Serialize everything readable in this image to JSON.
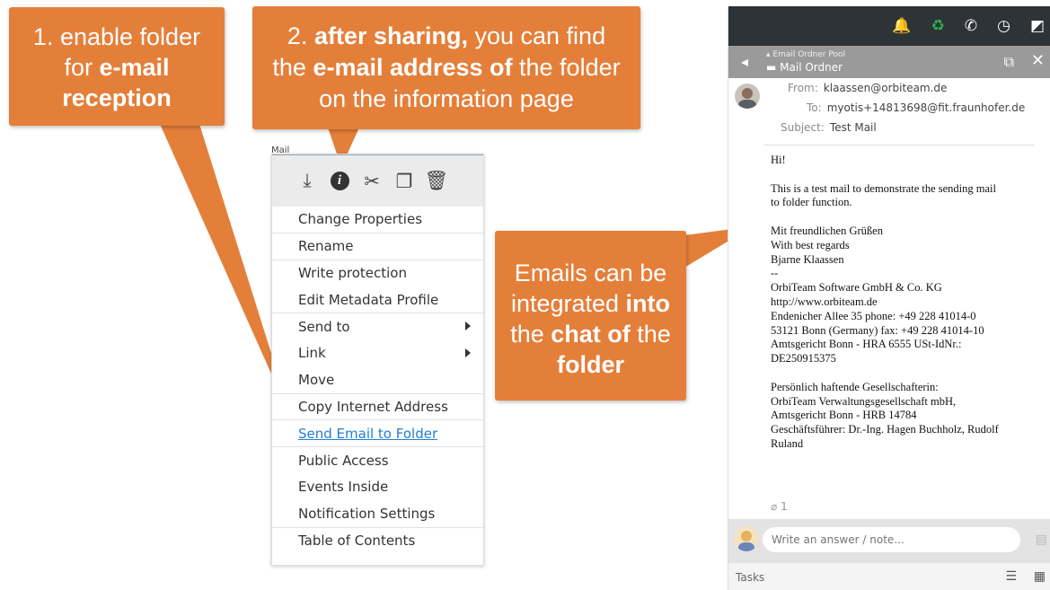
{
  "callouts": {
    "c1": {
      "l1_a": "1.",
      "l1_b": " enable folder",
      "l2_a": "for ",
      "l2_b": "e-mail",
      "l3": "reception"
    },
    "c2": {
      "l1_a": "2. ",
      "l1_b": "after sharing,",
      "l1_c": " you can find",
      "l2_a": "the ",
      "l2_b": "e-mail address of",
      "l2_c": " the folder",
      "l3": "on the information page"
    },
    "c3": {
      "l1": "Emails can be",
      "l2_a": "integrated ",
      "l2_b": "into",
      "l3_a": "the ",
      "l3_b": "chat of",
      "l3_c": " the",
      "l4": "folder"
    },
    "color": "#e47f3a"
  },
  "context_menu": {
    "clip_label": "Mail",
    "toolbar_icons": [
      "download-icon",
      "info-icon",
      "cut-icon",
      "copy-icon",
      "trash-icon"
    ],
    "items": [
      {
        "label": "Change Properties"
      },
      {
        "label": "Rename"
      },
      {
        "label": "Write protection"
      },
      {
        "label": "Edit Metadata Profile"
      },
      {
        "label": "Send to"
      },
      {
        "label": "Link"
      },
      {
        "label": "Move"
      },
      {
        "label": "Copy Internet Address"
      },
      {
        "label": "Send Email to Folder"
      },
      {
        "label": "Public Access"
      },
      {
        "label": "Events Inside"
      },
      {
        "label": "Notification Settings"
      },
      {
        "label": "Table of Contents"
      }
    ],
    "link_color": "#1f7fd6"
  },
  "mail_panel": {
    "breadcrumb": "Email Ordner Pool",
    "folder_title": "Mail Ordner",
    "header": {
      "from_label": "From:",
      "from_value": "klaassen@orbiteam.de",
      "to_label": "To:",
      "to_value": "myotis+14813698@fit.fraunhofer.de",
      "subject_label": "Subject:",
      "subject_value": "Test Mail"
    },
    "body": {
      "greeting": "Hi!",
      "para1_l1": "This is a test mail to demonstrate the sending mail",
      "para1_l2": "to folder function.",
      "sig1": "Mit freundlichen Grüßen",
      "sig2": "With best regards",
      "sig3": "Bjarne Klaassen",
      "sig4": "--",
      "sig5": "OrbiTeam Software GmbH & Co. KG",
      "sig6": "http://www.orbiteam.de",
      "sig7": "Endenicher Allee 35 phone: +49 228 41014-0",
      "sig8": "53121 Bonn (Germany) fax: +49 228 41014-10",
      "sig9": "Amtsgericht Bonn - HRA 6555 USt-IdNr.:",
      "sig10": "DE250915375",
      "legal1": "Persönlich haftende Gesellschafterin:",
      "legal2": "OrbiTeam Verwaltungsgesellschaft mbH,",
      "legal3": "Amtsgericht Bonn - HRB 14784",
      "legal4": "Geschäftsführer: Dr.-Ing. Hagen Buchholz, Rudolf",
      "legal5": "Ruland"
    },
    "attachment_count": "1",
    "reply_placeholder": "Write an answer / note...",
    "tasks_label": "Tasks",
    "topbar_bg": "#2e3338",
    "subbar_bg": "#9a9a9a",
    "green_icon": "#2fb24a"
  }
}
